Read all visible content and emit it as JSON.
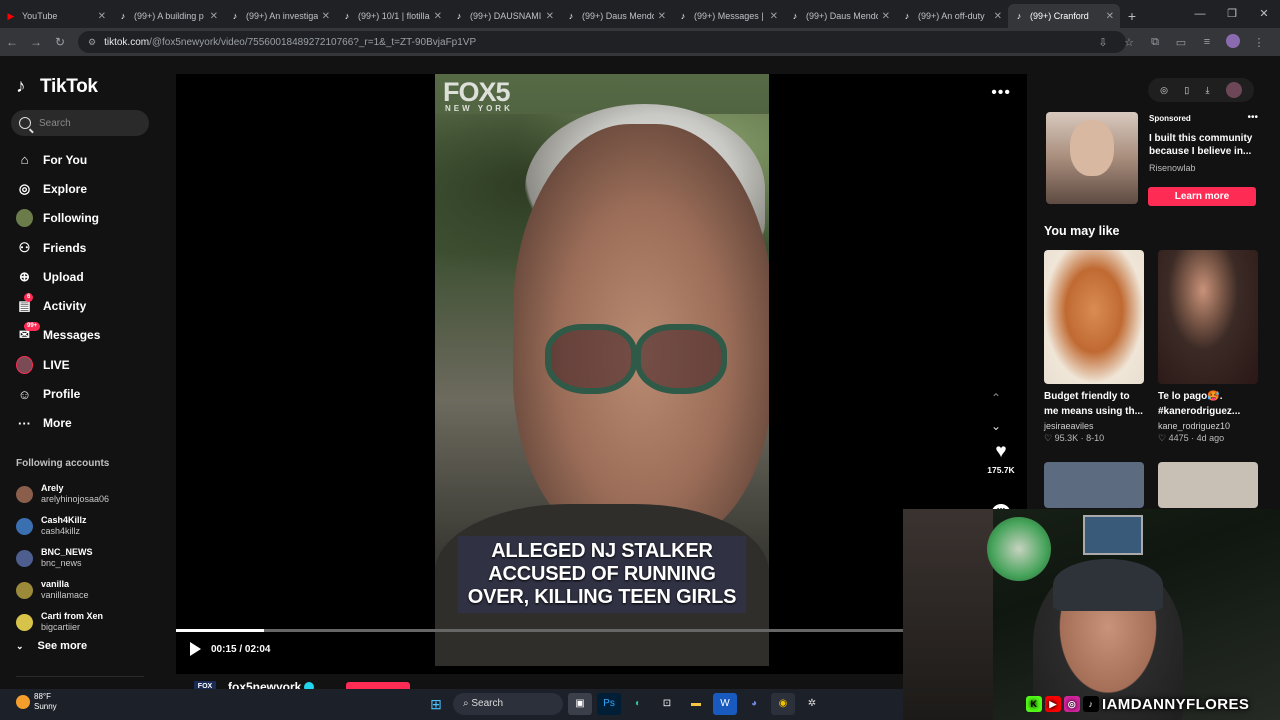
{
  "browser": {
    "tabs": [
      {
        "label": "YouTube",
        "icon": "youtube-icon"
      },
      {
        "label": "(99+) A building p",
        "icon": "tiktok-icon"
      },
      {
        "label": "(99+) An investiga",
        "icon": "tiktok-icon"
      },
      {
        "label": "(99+) 10/1 | flotilla",
        "icon": "tiktok-icon"
      },
      {
        "label": "(99+) DAUSNAMI",
        "icon": "tiktok-icon"
      },
      {
        "label": "(99+) Daus Mendo",
        "icon": "tiktok-icon"
      },
      {
        "label": "(99+) Messages | T",
        "icon": "tiktok-icon"
      },
      {
        "label": "(99+) Daus Mendo",
        "icon": "tiktok-icon"
      },
      {
        "label": "(99+) An off-duty",
        "icon": "tiktok-icon"
      },
      {
        "label": "(99+) Cranford",
        "icon": "tiktok-icon",
        "active": true
      }
    ],
    "url_domain": "tiktok.com",
    "url_path": "/@fox5newyork/video/7556001848927210766?_r=1&_t=ZT-90BvjaFp1VP"
  },
  "sidebar": {
    "logo": "TikTok",
    "search_placeholder": "Search",
    "nav": [
      {
        "label": "For You",
        "icon": "home-icon"
      },
      {
        "label": "Explore",
        "icon": "compass-icon"
      },
      {
        "label": "Following",
        "icon": "following-avatar"
      },
      {
        "label": "Friends",
        "icon": "friends-icon"
      },
      {
        "label": "Upload",
        "icon": "upload-icon"
      },
      {
        "label": "Activity",
        "icon": "activity-icon",
        "badge": "6"
      },
      {
        "label": "Messages",
        "icon": "messages-icon",
        "badge": "99+"
      },
      {
        "label": "LIVE",
        "icon": "live-avatar"
      },
      {
        "label": "Profile",
        "icon": "profile-icon"
      },
      {
        "label": "More",
        "icon": "more-icon"
      }
    ],
    "following_heading": "Following accounts",
    "accounts": [
      {
        "name": "Arely",
        "handle": "arelyhinojosaa06",
        "color": "#8b5e4c"
      },
      {
        "name": "Cash4Killz",
        "handle": "cash4killz",
        "color": "#3a6fb0"
      },
      {
        "name": "BNC_NEWS",
        "handle": "bnc_news",
        "color": "#4d5e8f"
      },
      {
        "name": "vanilla",
        "handle": "vanillamace",
        "color": "#9b8a3a"
      },
      {
        "name": "Carti from Xen",
        "handle": "bigcartiier",
        "color": "#d8c34a"
      }
    ],
    "see_more": "See more"
  },
  "video": {
    "watermark": "FOX5",
    "watermark_sub": "NEW YORK",
    "caption": "ALLEGED NJ STALKER ACCUSED OF RUNNING OVER, KILLING TEEN GIRLS",
    "time": "00:15 / 02:04",
    "progress": 0.121,
    "likes": "175.7K",
    "author": "fox5newyork",
    "author_logo": "FOX"
  },
  "ad": {
    "label": "Sponsored",
    "text": "I built this community because I believe in...",
    "source": "Risenowlab",
    "button": "Learn more"
  },
  "you_may_like": {
    "heading": "You may like",
    "items": [
      {
        "caption": "Budget friendly to me means using th...",
        "user": "jesiraeaviles",
        "stats": "♡ 95.3K · 8-10"
      },
      {
        "caption": "Te lo pago🥵. #kanerodriguez...",
        "user": "kane_rodriguez10",
        "stats": "♡ 4475 · 4d ago"
      }
    ]
  },
  "overlay": {
    "brand": "IAMDANNYFLORES"
  },
  "taskbar": {
    "temp": "88°F",
    "condition": "Sunny",
    "search": "Search"
  }
}
